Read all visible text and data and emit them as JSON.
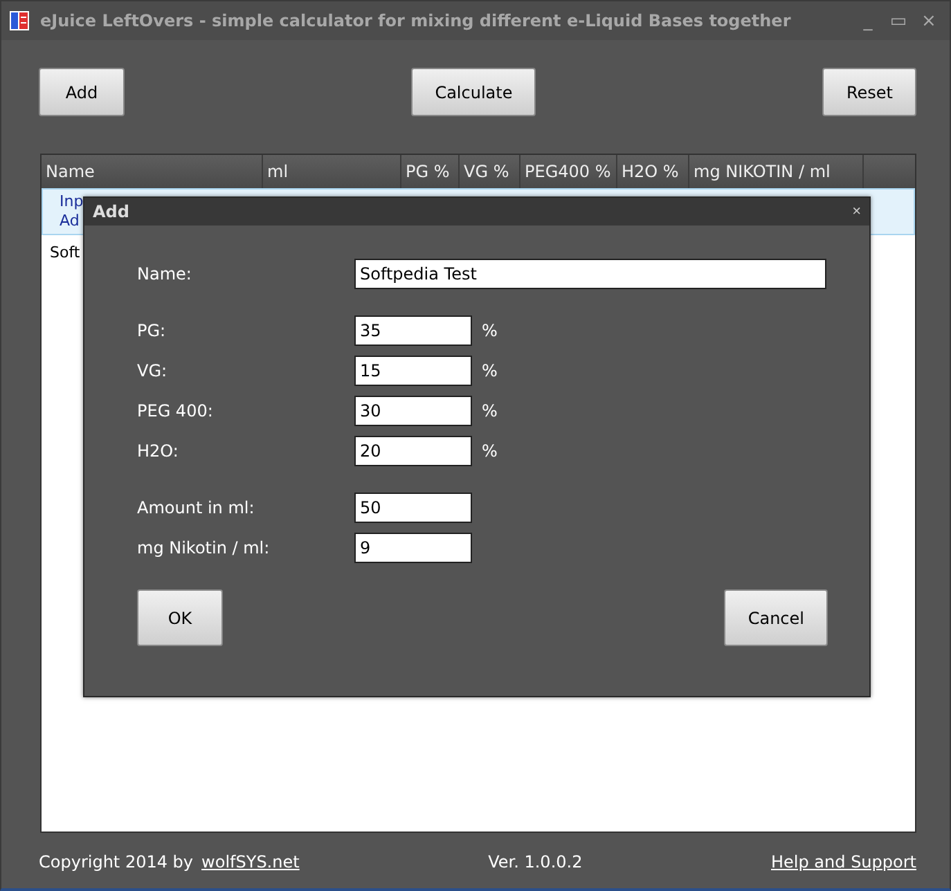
{
  "window": {
    "title": "eJuice LeftOvers - simple calculator for mixing different e-Liquid Bases together",
    "controls": [
      "_",
      "▭",
      "×"
    ]
  },
  "toolbar": [
    "Add",
    "Calculate",
    "Reset"
  ],
  "table": {
    "columns": [
      "Name",
      "ml",
      "PG %",
      "VG %",
      "PEG400 %",
      "H2O %",
      "mg NIKOTIN / ml"
    ],
    "rows": [
      {
        "lines": [
          "Inp",
          "Ad"
        ],
        "selected": true
      },
      {
        "lines": [
          "Soft"
        ],
        "selected": false
      }
    ]
  },
  "footer": {
    "copyright": "Copyright 2014 by",
    "link": "wolfSYS.net",
    "version": "Ver. 1.0.0.2",
    "help": "Help and Support"
  },
  "dialog": {
    "title": "Add",
    "close": "×",
    "groups": [
      [
        {
          "label": "Name:",
          "value": "Softpedia Test",
          "kind": "wide"
        }
      ],
      [
        {
          "label": "PG:",
          "value": "35",
          "kind": "percent",
          "unit": "%"
        },
        {
          "label": "VG:",
          "value": "15",
          "kind": "percent",
          "unit": "%"
        },
        {
          "label": "PEG 400:",
          "value": "30",
          "kind": "percent",
          "unit": "%"
        },
        {
          "label": "H2O:",
          "value": "20",
          "kind": "percent",
          "unit": "%"
        }
      ],
      [
        {
          "label": "Amount in ml:",
          "value": "50",
          "kind": "plain"
        },
        {
          "label": "mg Nikotin / ml:",
          "value": "9",
          "kind": "plain"
        }
      ]
    ],
    "buttons": [
      "OK",
      "Cancel"
    ]
  }
}
